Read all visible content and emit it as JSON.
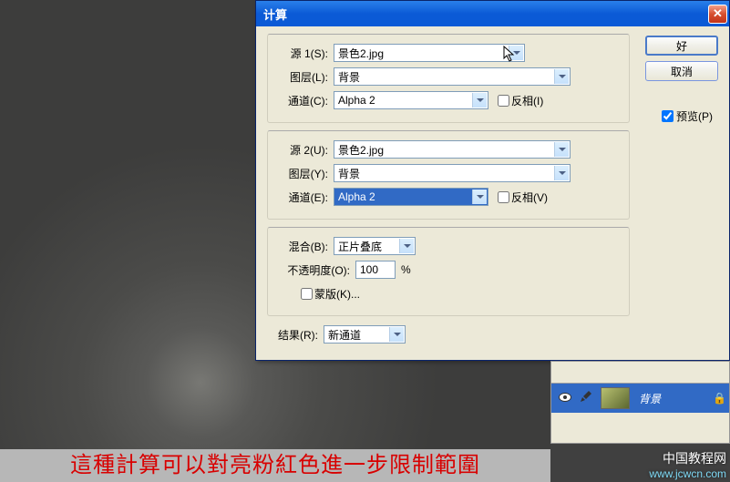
{
  "dialog": {
    "title": "计算",
    "source1": {
      "legend": "源 1(S):",
      "file": "景色2.jpg",
      "layer_label": "图层(L):",
      "layer": "背景",
      "channel_label": "通道(C):",
      "channel": "Alpha 2",
      "invert": "反相(I)"
    },
    "source2": {
      "legend": "源 2(U):",
      "file": "景色2.jpg",
      "layer_label": "图层(Y):",
      "layer": "背景",
      "channel_label": "通道(E):",
      "channel": "Alpha 2",
      "invert": "反相(V)"
    },
    "blending": {
      "label": "混合(B):",
      "mode": "正片叠底",
      "opacity_label": "不透明度(O):",
      "opacity": "100",
      "opacity_unit": "%",
      "mask": "蒙版(K)..."
    },
    "result": {
      "label": "结果(R):",
      "value": "新通道"
    },
    "buttons": {
      "ok": "好",
      "cancel": "取消"
    },
    "preview": "预览(P)"
  },
  "layers": {
    "bg_name": "背景"
  },
  "caption": "這種計算可以對亮粉紅色進一步限制範圍",
  "watermark": {
    "site": "中国教程网",
    "url": "www.jcwcn.com"
  }
}
